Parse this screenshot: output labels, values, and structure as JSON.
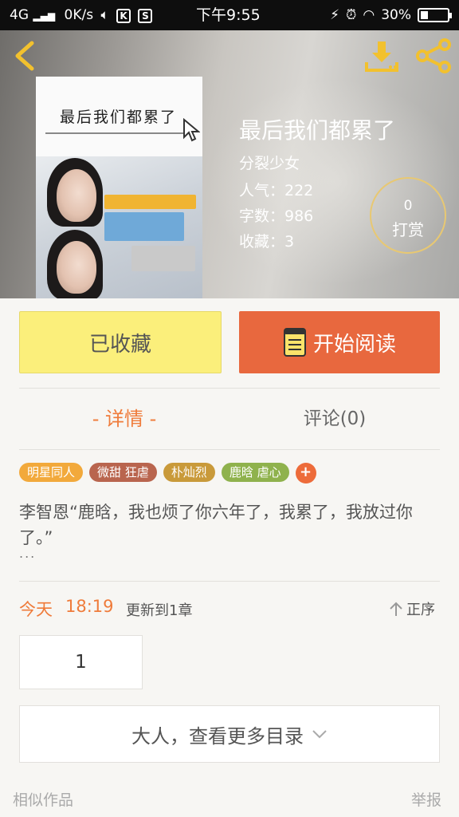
{
  "status_bar": {
    "network": "4G",
    "speed": "0K/s",
    "k_badge": "K",
    "s_badge": "S",
    "time": "下午9:55",
    "battery": "30%"
  },
  "header": {
    "cover_title": "最后我们都累了",
    "book_title": "最后我们都累了",
    "author": "分裂少女",
    "popularity": "人气：222",
    "word_count": "字数：986",
    "favorites": "收藏：3",
    "reward_count": "0",
    "reward_label": "打赏"
  },
  "actions": {
    "favorite_label": "已收藏",
    "read_label": "开始阅读"
  },
  "tabs": {
    "detail": "- 详情 -",
    "comments": "评论(0)"
  },
  "tags": [
    {
      "label": "明星同人",
      "color": "#f2a93b"
    },
    {
      "label": "微甜 狂虐",
      "color": "#b9654e"
    },
    {
      "label": "朴灿烈",
      "color": "#c99a3a"
    },
    {
      "label": "鹿晗 虐心",
      "color": "#8fb24d"
    }
  ],
  "tag_add": "+",
  "intro": {
    "text": "李智恩“鹿晗，我也烦了你六年了，我累了，我放过你了。”",
    "more": "..."
  },
  "update": {
    "day": "今天",
    "time": "18:19",
    "text": "更新到1章",
    "sort_label": "正序"
  },
  "chapter": {
    "number": "1"
  },
  "more_catalog": "大人，查看更多目录",
  "footer": {
    "similar": "相似作品",
    "report": "举报"
  },
  "colors": {
    "accent": "#ef7b3a",
    "favorite_bg": "#fbef7b",
    "read_bg": "#e8683e"
  }
}
